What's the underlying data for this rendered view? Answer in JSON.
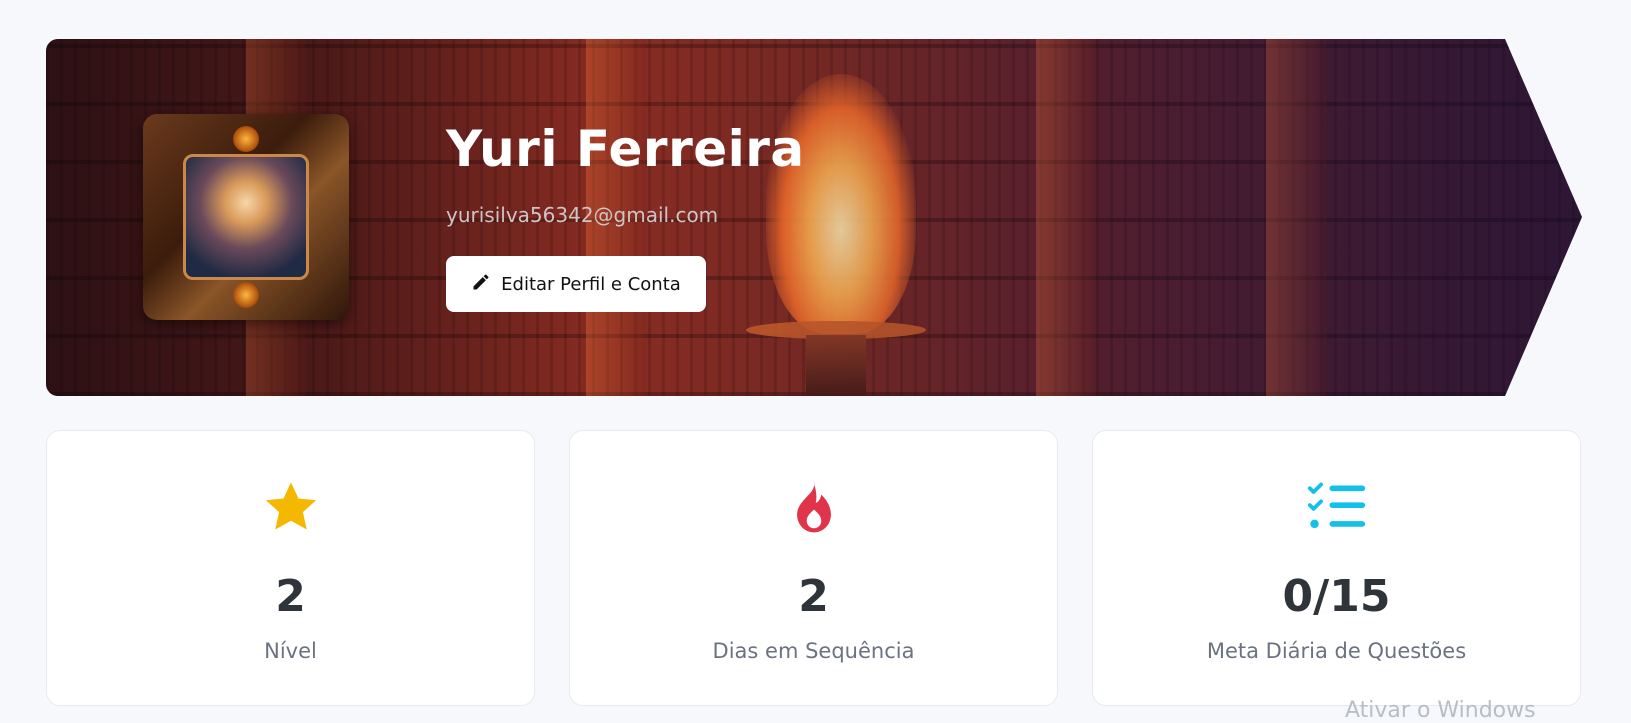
{
  "profile": {
    "name": "Yuri Ferreira",
    "email": "yurisilva56342@gmail.com",
    "edit_button_label": "Editar Perfil e Conta",
    "edit_icon": "pencil-icon"
  },
  "stats": [
    {
      "value": "2",
      "label": "Nível",
      "icon": "star-icon",
      "icon_color": "#f5b800"
    },
    {
      "value": "2",
      "label": "Dias em Sequência",
      "icon": "fire-icon",
      "icon_color": "#e0344a"
    },
    {
      "value": "0/15",
      "label": "Meta Diária de Questões",
      "icon": "checklist-icon",
      "icon_color": "#12c0e8"
    }
  ],
  "watermark": "Ativar o Windows"
}
